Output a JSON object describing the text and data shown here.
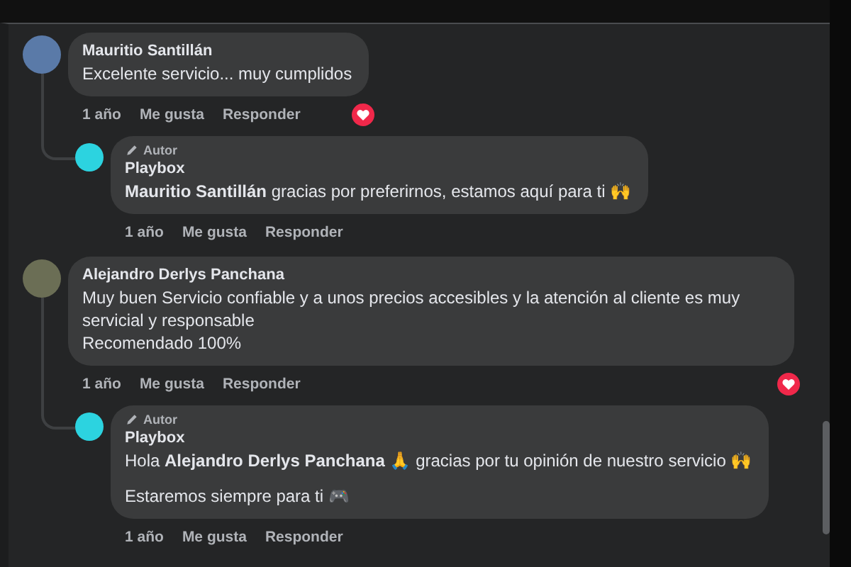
{
  "comments": [
    {
      "author": "Mauritio Santillán",
      "paragraphs": [
        "Excelente servicio... muy cumplidos"
      ],
      "time": "1 año",
      "like": "Me gusta",
      "reply": "Responder",
      "reacted": true,
      "replies": [
        {
          "badge": "Autor",
          "author": "Playbox",
          "paragraphs": [
            "**Mauritio Santillán** gracias por preferirnos, estamos aquí para ti 🙌"
          ],
          "time": "1 año",
          "like": "Me gusta",
          "reply": "Responder"
        }
      ]
    },
    {
      "author": "Alejandro Derlys Panchana",
      "paragraphs": [
        "Muy buen Servicio confiable y a unos precios accesibles y la atención al cliente es muy servicial y responsable",
        "Recomendado 100%"
      ],
      "time": "1 año",
      "like": "Me gusta",
      "reply": "Responder",
      "reacted": true,
      "replies": [
        {
          "badge": "Autor",
          "author": "Playbox",
          "paragraphs": [
            "Hola **Alejandro Derlys Panchana** 🙏 gracias por tu opinión de nuestro servicio 🙌",
            "Estaremos siempre para ti 🎮"
          ],
          "time": "1 año",
          "like": "Me gusta",
          "reply": "Responder"
        }
      ]
    }
  ]
}
